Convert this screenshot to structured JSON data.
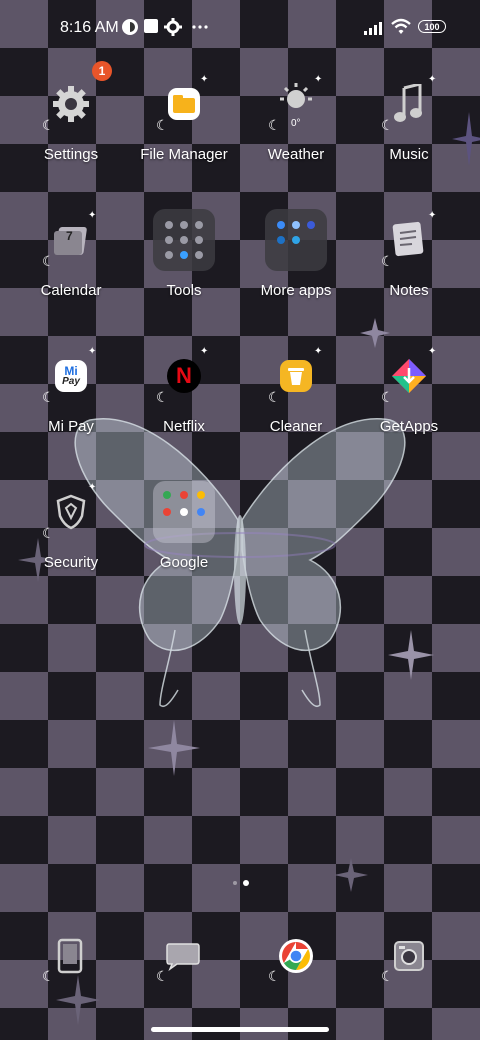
{
  "status_bar": {
    "time": "8:16 AM",
    "battery": "100",
    "icons": [
      "meta-icon",
      "square-icon",
      "gear-icon",
      "more-dots-icon",
      "signal-icon",
      "wifi-icon",
      "battery-icon"
    ]
  },
  "apps": {
    "settings": {
      "label": "Settings",
      "badge": "1"
    },
    "file_manager": {
      "label": "File Manager"
    },
    "weather": {
      "label": "Weather",
      "temp": "0°"
    },
    "music": {
      "label": "Music"
    },
    "calendar": {
      "label": "Calendar",
      "day": "7"
    },
    "tools": {
      "label": "Tools"
    },
    "more_apps": {
      "label": "More apps"
    },
    "notes": {
      "label": "Notes"
    },
    "mi_pay": {
      "label": "Mi Pay",
      "icon_top": "Mi",
      "icon_bottom": "Pay"
    },
    "netflix": {
      "label": "Netflix",
      "icon_text": "N"
    },
    "cleaner": {
      "label": "Cleaner"
    },
    "getapps": {
      "label": "GetApps"
    },
    "security": {
      "label": "Security"
    },
    "google": {
      "label": "Google"
    }
  },
  "dock": [
    "phone-icon",
    "messages-icon",
    "chrome-icon",
    "camera-icon"
  ],
  "colors": {
    "badge": "#e8552a",
    "file_manager": "#f7b21b",
    "netflix": "#e50914",
    "cleaner": "#f5b623",
    "checker_dark": "#1c1a21",
    "checker_light": "#5d5567"
  }
}
